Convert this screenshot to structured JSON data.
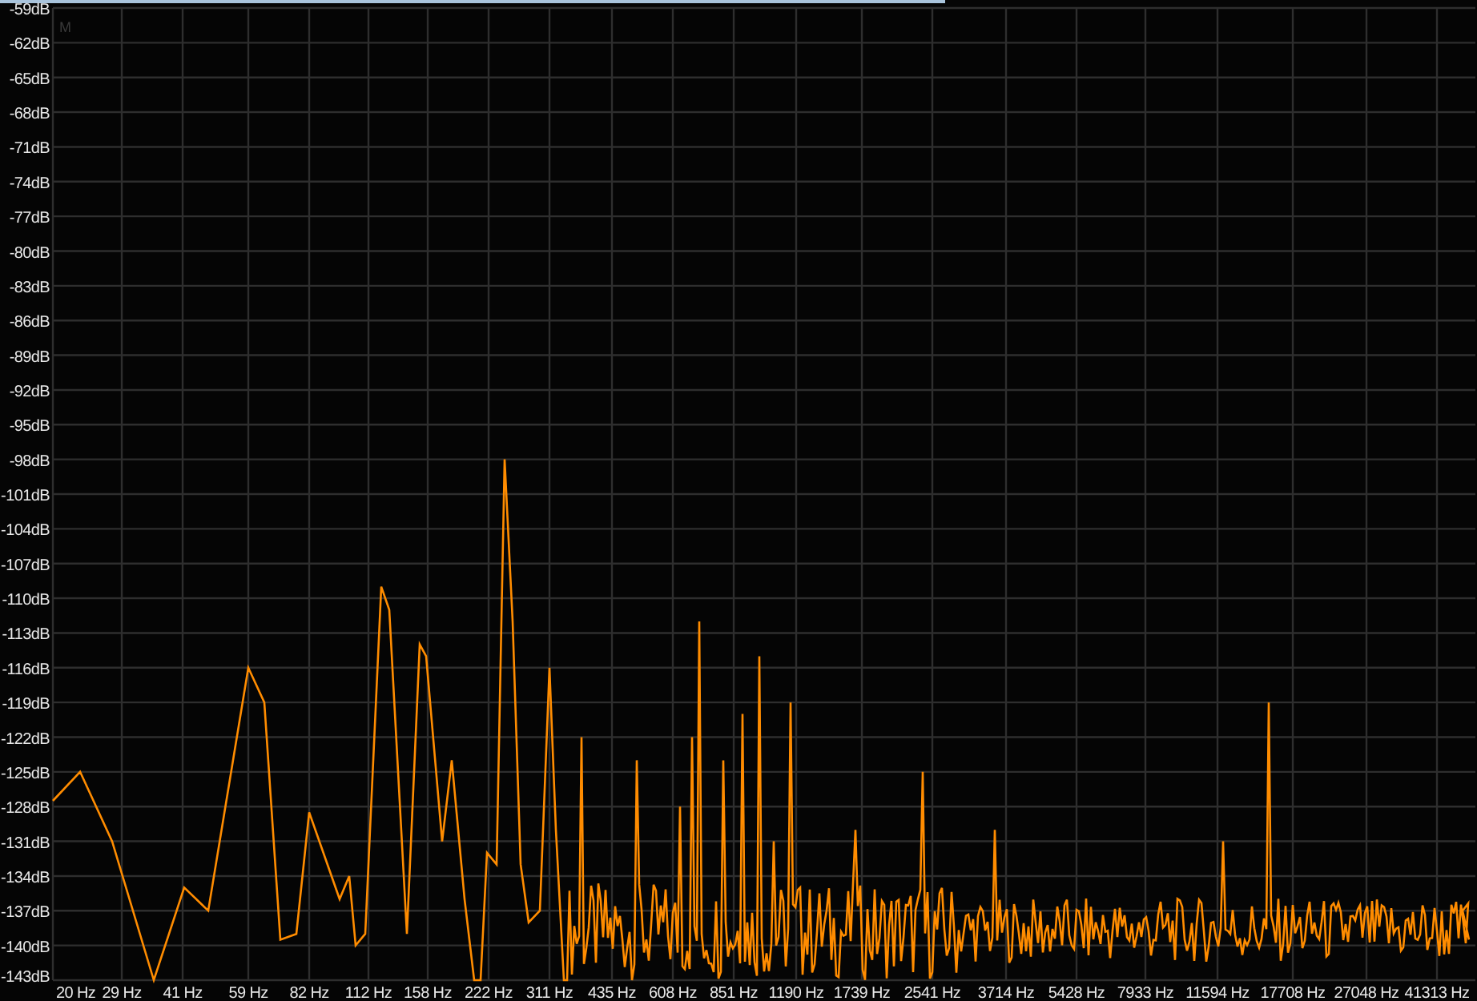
{
  "spectrum": {
    "marker": "M",
    "y_axis_labels": [
      "-59dB",
      "-62dB",
      "-65dB",
      "-68dB",
      "-71dB",
      "-74dB",
      "-77dB",
      "-80dB",
      "-83dB",
      "-86dB",
      "-89dB",
      "-92dB",
      "-95dB",
      "-98dB",
      "-101dB",
      "-104dB",
      "-107dB",
      "-110dB",
      "-113dB",
      "-116dB",
      "-119dB",
      "-122dB",
      "-125dB",
      "-128dB",
      "-131dB",
      "-134dB",
      "-137dB",
      "-140dB",
      "-143dB"
    ],
    "x_axis_labels": [
      "20 Hz",
      "29 Hz",
      "41 Hz",
      "59 Hz",
      "82 Hz",
      "112 Hz",
      "158 Hz",
      "222 Hz",
      "311 Hz",
      "435 Hz",
      "608 Hz",
      "851 Hz",
      "1190 Hz",
      "1739 Hz",
      "2541 Hz",
      "3714 Hz",
      "5428 Hz",
      "7933 Hz",
      "11594 Hz",
      "17708 Hz",
      "27048 Hz",
      "41313 Hz"
    ]
  }
}
